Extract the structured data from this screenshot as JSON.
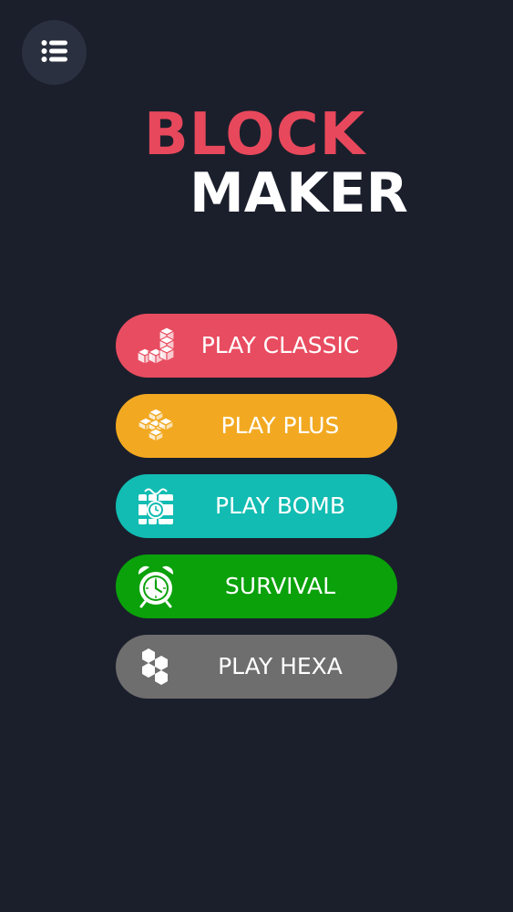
{
  "menu": {
    "icon": "list-menu-icon"
  },
  "title": {
    "line1": "BLOCK",
    "line2": "MAKER",
    "line1_color": "#e8485c",
    "line2_color": "#ffffff"
  },
  "buttons": [
    {
      "label": "PLAY CLASSIC",
      "color": "#e84c60",
      "icon": "stair-blocks-icon"
    },
    {
      "label": "PLAY PLUS",
      "color": "#f2a921",
      "icon": "plus-blocks-icon"
    },
    {
      "label": "PLAY BOMB",
      "color": "#12bcb2",
      "icon": "time-bomb-icon"
    },
    {
      "label": "SURVIVAL",
      "color": "#0aa10a",
      "icon": "alarm-clock-icon"
    },
    {
      "label": "PLAY HEXA",
      "color": "#6e6e6e",
      "icon": "hexagons-icon"
    }
  ]
}
